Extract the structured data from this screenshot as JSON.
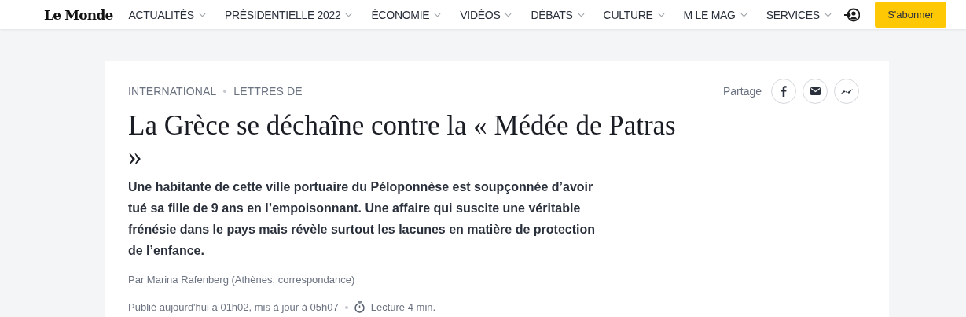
{
  "header": {
    "logo": "Le Monde",
    "nav": [
      "ACTUALITÉS",
      "PRÉSIDENTIELLE 2022",
      "ÉCONOMIE",
      "VIDÉOS",
      "DÉBATS",
      "CULTURE",
      "M LE MAG",
      "SERVICES"
    ],
    "subscribe_button": "S'abonner"
  },
  "article": {
    "breadcrumb": [
      "INTERNATIONAL",
      "LETTRES DE"
    ],
    "share_label": "Partage",
    "title": "La Grèce se déchaîne contre la « Médée de Patras »",
    "summary": "Une habitante de cette ville portuaire du Péloponnèse est soupçonnée d’avoir tué sa fille de 9 ans en l’empoisonnant. Une affaire qui suscite une véritable frénésie dans le pays mais révèle surtout les lacunes en matière de protection de l’enfance.",
    "byline": "Par Marina Rafenberg (Athènes, correspondance)",
    "published": "Publié aujourd'hui à 01h02, mis à jour à 05h07",
    "reading_time": "Lecture 4 min."
  }
}
